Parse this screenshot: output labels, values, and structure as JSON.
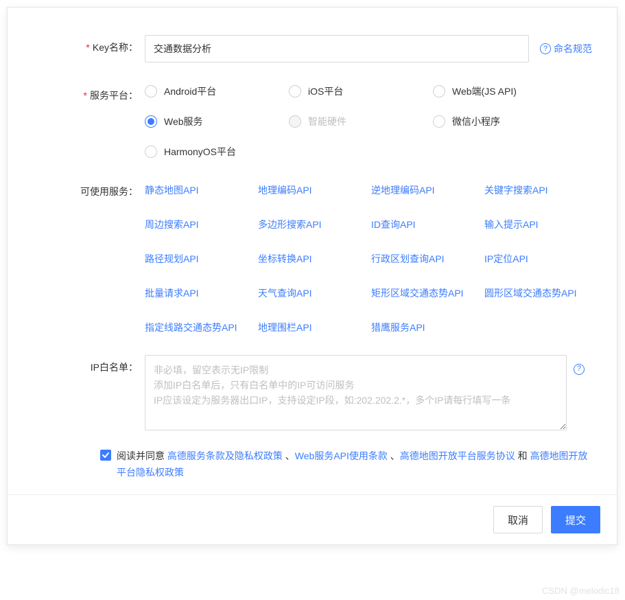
{
  "form": {
    "keyName": {
      "label": "Key名称：",
      "value": "交通数据分析",
      "namingLink": "命名规范"
    },
    "platform": {
      "label": "服务平台：",
      "options": [
        {
          "label": "Android平台",
          "selected": false,
          "disabled": false
        },
        {
          "label": "iOS平台",
          "selected": false,
          "disabled": false
        },
        {
          "label": "Web端(JS API)",
          "selected": false,
          "disabled": false
        },
        {
          "label": "Web服务",
          "selected": true,
          "disabled": false
        },
        {
          "label": "智能硬件",
          "selected": false,
          "disabled": true
        },
        {
          "label": "微信小程序",
          "selected": false,
          "disabled": false
        },
        {
          "label": "HarmonyOS平台",
          "selected": false,
          "disabled": false
        }
      ]
    },
    "services": {
      "label": "可使用服务：",
      "items": [
        "静态地图API",
        "地理编码API",
        "逆地理编码API",
        "关键字搜索API",
        "周边搜索API",
        "多边形搜索API",
        "ID查询API",
        "输入提示API",
        "路径规划API",
        "坐标转换API",
        "行政区划查询API",
        "IP定位API",
        "批量请求API",
        "天气查询API",
        "矩形区域交通态势API",
        "圆形区域交通态势API",
        "指定线路交通态势API",
        "地理围栏API",
        "猎鹰服务API"
      ]
    },
    "ipWhitelist": {
      "label": "IP白名单：",
      "placeholder": "非必填，留空表示无IP限制\n添加IP白名单后，只有白名单中的IP可访问服务\nIP应该设定为服务器出口IP，支持设定IP段，如:202.202.2.*，多个IP请每行填写一条",
      "value": ""
    },
    "agreement": {
      "checked": true,
      "prefix": "阅读并同意 ",
      "links": [
        "高德服务条款及隐私权政策",
        "Web服务API使用条款",
        "高德地图开放平台服务协议",
        "高德地图开放平台隐私权政策"
      ],
      "sep1": " 、",
      "sep2": " 、",
      "sep3": " 和 "
    }
  },
  "footer": {
    "cancel": "取消",
    "submit": "提交"
  },
  "watermark": "CSDN @melodic18"
}
